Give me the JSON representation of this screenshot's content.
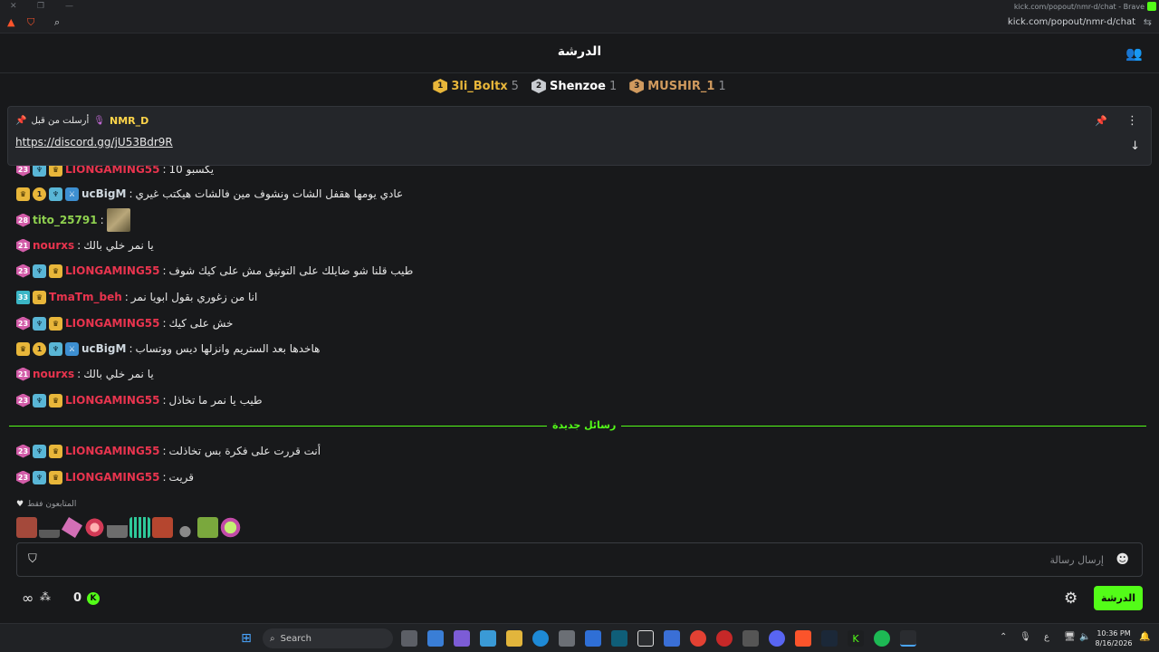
{
  "browser": {
    "window_title": "kick.com/popout/nmr-d/chat - Brave",
    "url": "kick.com/popout/nmr-d/chat"
  },
  "header": {
    "title": "الدرشة"
  },
  "leaderboard": [
    {
      "rank": "1",
      "name": "3li_Boltx",
      "count": "5",
      "color": "#e8b63a"
    },
    {
      "rank": "2",
      "name": "Shenzoe",
      "count": "1",
      "color": "#c9ccd1"
    },
    {
      "rank": "3",
      "name": "MUSHIR_1",
      "count": "1",
      "color": "#d09a5e"
    }
  ],
  "pinned": {
    "user": "NMR_D",
    "sent_by_label": "أرسلت من قبل",
    "link": "https://discord.gg/jU53Bdr9R"
  },
  "messages": [
    {
      "badges": [
        "sub:23",
        "og",
        "crown"
      ],
      "user": "LIONGAMING55",
      "color": "#e8344e",
      "text": "يكسبو 10"
    },
    {
      "badges": [
        "crown",
        "one:1",
        "og",
        "mod"
      ],
      "user": "ucBigM",
      "color": "#cfd8df",
      "text": "عادي يومها هقفل الشات ونشوف مين فالشات هيكتب غيري"
    },
    {
      "badges": [
        "sub:28"
      ],
      "user": "tito_25791",
      "color": "#8fd14f",
      "text": "",
      "emote": true
    },
    {
      "badges": [
        "sub:21"
      ],
      "user": "nourxs",
      "color": "#e8344e",
      "text": "يا نمر خلي بالك"
    },
    {
      "badges": [
        "sub:23",
        "og",
        "crown"
      ],
      "user": "LIONGAMING55",
      "color": "#e8344e",
      "text": "طيب قلنا شو ضايلك على التوثيق مش على كيك شوف"
    },
    {
      "badges": [
        "sub33:33",
        "crown"
      ],
      "user": "TmaTm_beh",
      "color": "#e8344e",
      "text": "انا من زغوري بقول ابويا نمر"
    },
    {
      "badges": [
        "sub:23",
        "og",
        "crown"
      ],
      "user": "LIONGAMING55",
      "color": "#e8344e",
      "text": "خش على كيك"
    },
    {
      "badges": [
        "crown",
        "one:1",
        "og",
        "mod"
      ],
      "user": "ucBigM",
      "color": "#cfd8df",
      "text": "هاخدها بعد الستريم وانزلها ديس ووتساب"
    },
    {
      "badges": [
        "sub:21"
      ],
      "user": "nourxs",
      "color": "#e8344e",
      "text": "يا نمر خلي بالك"
    },
    {
      "badges": [
        "sub:23",
        "og",
        "crown"
      ],
      "user": "LIONGAMING55",
      "color": "#e8344e",
      "text": "طيب يا نمر ما تخاذل"
    },
    {
      "badges": [
        "sub:23",
        "og",
        "crown"
      ],
      "user": "LIONGAMING55",
      "color": "#e8344e",
      "text": "أنت قررت على فكرة بس تخاذلت"
    },
    {
      "badges": [
        "sub:23",
        "og",
        "crown"
      ],
      "user": "LIONGAMING55",
      "color": "#e8344e",
      "text": "قريت"
    }
  ],
  "new_messages_label": "رسائل جديدة",
  "emotes": {
    "label": "المتابعون فقط"
  },
  "input": {
    "placeholder": "إرسال رسالة"
  },
  "footer": {
    "count": "0",
    "chat_button": "الدرشة"
  },
  "taskbar": {
    "search_label": "Search",
    "time": "10:36 PM",
    "date": "8/16/2026"
  },
  "colors": {
    "accent": "#53fc18",
    "background": "#18191b"
  }
}
